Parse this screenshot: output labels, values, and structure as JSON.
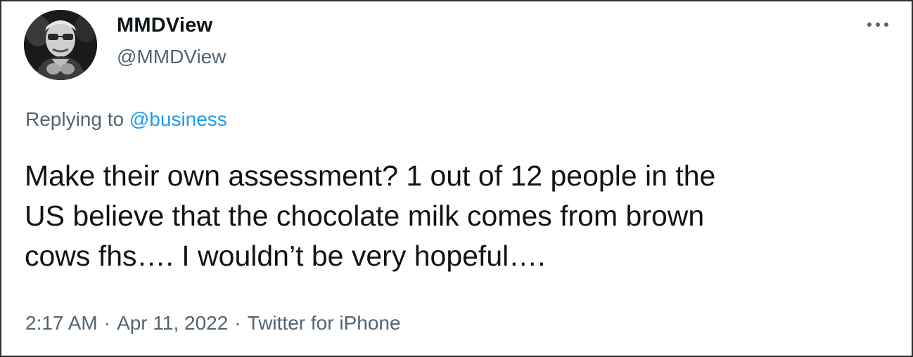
{
  "author": {
    "display_name": "MMDView",
    "handle": "@MMDView"
  },
  "reply": {
    "prefix": "Replying to",
    "mention": "@business"
  },
  "tweet": {
    "lines": [
      "Make their own assessment? 1 out of 12 people in the",
      "US believe that the chocolate milk comes from brown",
      "cows fhs…. I wouldn’t be very hopeful…."
    ]
  },
  "meta": {
    "time": "2:17 AM",
    "separator": "·",
    "date": "Apr 11, 2022",
    "source": "Twitter for iPhone"
  },
  "icons": {
    "more": "more-horizontal-icon",
    "avatar": "avatar-image"
  },
  "colors": {
    "link": "#1d9bf0",
    "secondary_text": "#536471",
    "primary_text": "#0f1419",
    "border": "#2f2f2f"
  }
}
